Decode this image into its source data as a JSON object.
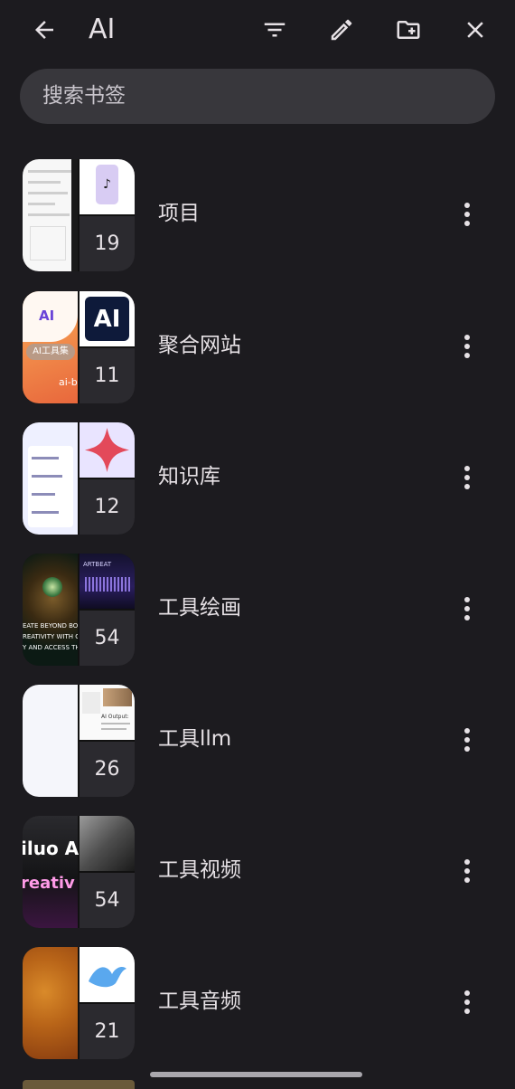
{
  "header": {
    "title": "AI",
    "icons": [
      "back-arrow-icon",
      "filter-icon",
      "edit-pencil-icon",
      "new-folder-icon",
      "close-icon"
    ]
  },
  "search": {
    "placeholder": "搜索书签"
  },
  "folders": [
    {
      "label": "项目",
      "count": "19"
    },
    {
      "label": "聚合网站",
      "count": "11"
    },
    {
      "label": "知识库",
      "count": "12"
    },
    {
      "label": "工具绘画",
      "count": "54"
    },
    {
      "label": "工具llm",
      "count": "26"
    },
    {
      "label": "工具视频",
      "count": "54"
    },
    {
      "label": "工具音频",
      "count": "21"
    }
  ],
  "thumbnail_text": {
    "ai_logo": "AI",
    "ai_badge": "AI工具集",
    "ai_site": "ai-b",
    "paint_caption": [
      "EATE BEYOND BOUND",
      "REATIVITY WITH OUR",
      "Y AND ACCESS THE W"
    ],
    "paint_app": "ARTBEAT",
    "llm_output": "AI Output:",
    "vid_brand": "iluo A",
    "vid_tag": "reativ"
  },
  "colors": {
    "background": "#1c1b1f",
    "search": "#38373c",
    "text": "#e6e1e5",
    "count_tile": "#2b2a2f"
  }
}
